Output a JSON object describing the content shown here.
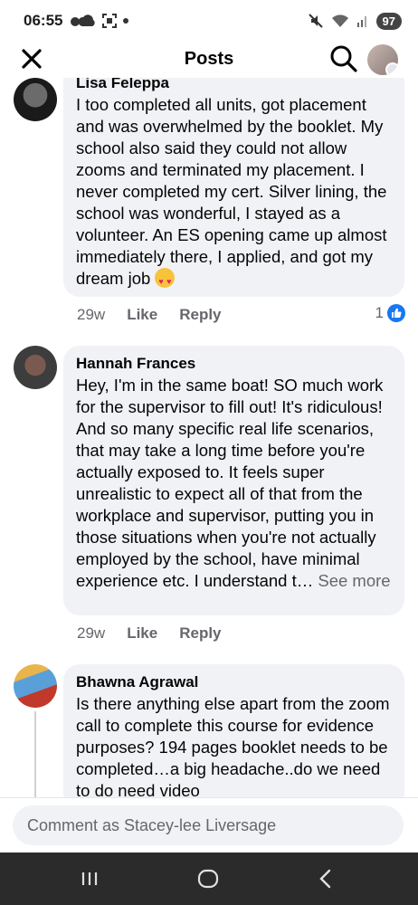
{
  "status_bar": {
    "time": "06:55",
    "battery": "97"
  },
  "header": {
    "title": "Posts"
  },
  "comments": [
    {
      "author": "Lisa Feleppa",
      "text": "I too completed all units, got placement and was overwhelmed by the booklet. My school also said they could not allow zooms and terminated my placement. I never completed my cert. Silver lining, the school was wonderful, I stayed as a volunteer. An ES opening came up almost immediately there, I applied, and got my dream job",
      "time": "29w",
      "like_label": "Like",
      "reply_label": "Reply",
      "reaction_count": "1"
    },
    {
      "author": "Hannah Frances",
      "text": "Hey, I'm in the same boat! SO much work for the supervisor to fill out! It's ridiculous! And so many specific real life scenarios, that may take a long time before you're actually exposed to. It feels super unrealistic to expect all of that from the workplace and supervisor, putting you in those situations when you're not actually employed by the school, have minimal experience etc. I understand t… ",
      "see_more": "See more",
      "time": "29w",
      "like_label": "Like",
      "reply_label": "Reply"
    },
    {
      "author": "Bhawna Agrawal",
      "text": "Is there anything else apart from the zoom call to complete this course for evidence purposes? 194 pages booklet needs to be completed…a big headache..do we need to do need video"
    }
  ],
  "composer": {
    "placeholder": "Comment as Stacey-lee Liversage"
  },
  "colors": {
    "accent": "#1877f2",
    "bubble": "#f0f2f5",
    "secondary_text": "#65676b"
  }
}
